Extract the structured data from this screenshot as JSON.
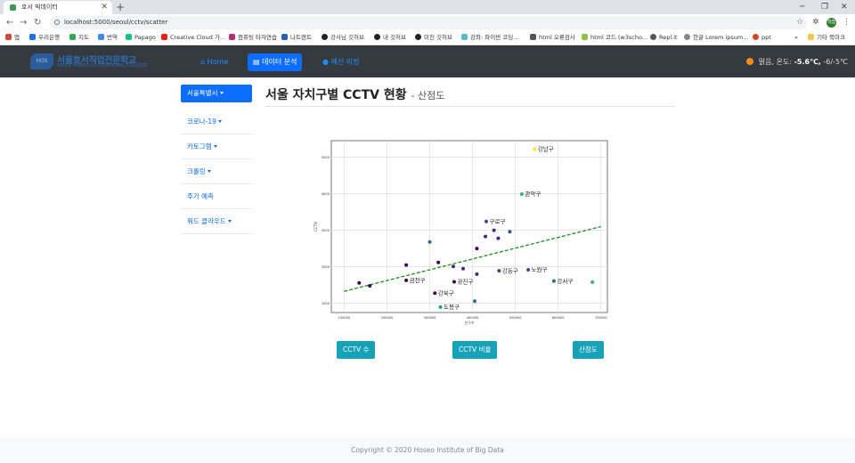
{
  "browser": {
    "tab_title": "호서 빅데이터",
    "url": "localhost:5000/seoul/cctv/scatter",
    "bookmarks": [
      "앱",
      "우리은행",
      "지도",
      "번역",
      "Papago",
      "Creative Cloud 가...",
      "컴퓨팅 타자연습",
      "나트렌트",
      "강사님 깃허브",
      "내 깃허브",
      "미진 깃허브",
      "강좌: 파이썬 코딩...",
      "html 오류검사",
      "html 코드 (w3scho...",
      "Repl.it",
      "한글 Lorem ipsum...",
      "ppt",
      "기타 북마크"
    ],
    "profile_badge": "학습"
  },
  "navbar": {
    "logo_title": "서울호서직업전문학교",
    "logo_subtitle": "SEOUL HOSEO OCCUPATIONAL COLLEGE",
    "items": [
      {
        "label": "Home",
        "active": false
      },
      {
        "label": "데이터 분석",
        "active": true
      },
      {
        "label": "예선 리빙",
        "active": false
      }
    ],
    "weather": {
      "condition": "맑음,",
      "temp_label": "온도:",
      "temp": "-5.6℃,",
      "range": "-6/-5℃"
    }
  },
  "sidebar": {
    "items": [
      {
        "label": "서울특별시",
        "dropdown": true,
        "active": true
      },
      {
        "label": "코로나-19",
        "dropdown": true,
        "active": false
      },
      {
        "label": "카토그램",
        "dropdown": true,
        "active": false
      },
      {
        "label": "크롤링",
        "dropdown": true,
        "active": false
      },
      {
        "label": "주가 예측",
        "dropdown": false,
        "active": false
      },
      {
        "label": "워드 클라우드",
        "dropdown": true,
        "active": false
      }
    ]
  },
  "main": {
    "title": "서울 자치구별 CCTV 현황",
    "subtitle": "- 산점도",
    "buttons": [
      "CCTV 수",
      "CCTV 비율",
      "산점도"
    ]
  },
  "chart_data": {
    "type": "scatter",
    "xlabel": "인구수",
    "ylabel": "CCTV",
    "xlim": [
      70000,
      715000
    ],
    "ylim": [
      750,
      5450
    ],
    "xticks": [
      100000,
      200000,
      300000,
      400000,
      500000,
      600000,
      700000
    ],
    "yticks": [
      1000,
      2000,
      3000,
      4000,
      5000
    ],
    "grid": true,
    "trendline": {
      "x": [
        100000,
        700000
      ],
      "y": [
        1330,
        3100
      ],
      "color": "#228b22",
      "style": "dashed"
    },
    "points": [
      {
        "x": 545000,
        "y": 5220,
        "label": "강남구",
        "color": "#fde725"
      },
      {
        "x": 515000,
        "y": 3990,
        "label": "관악구",
        "color": "#35b779"
      },
      {
        "x": 432000,
        "y": 3240,
        "label": "구로구",
        "color": "#3e4a89"
      },
      {
        "x": 450000,
        "y": 3000,
        "label": "",
        "color": "#482878"
      },
      {
        "x": 487000,
        "y": 2960,
        "label": "",
        "color": "#3e4a89"
      },
      {
        "x": 430000,
        "y": 2830,
        "label": "",
        "color": "#482878"
      },
      {
        "x": 460000,
        "y": 2780,
        "label": "",
        "color": "#482878"
      },
      {
        "x": 300000,
        "y": 2680,
        "label": "",
        "color": "#31688e"
      },
      {
        "x": 410000,
        "y": 2500,
        "label": "",
        "color": "#440154"
      },
      {
        "x": 245000,
        "y": 2050,
        "label": "",
        "color": "#440154"
      },
      {
        "x": 320000,
        "y": 2120,
        "label": "",
        "color": "#440154"
      },
      {
        "x": 355000,
        "y": 2010,
        "label": "",
        "color": "#482878"
      },
      {
        "x": 378000,
        "y": 1950,
        "label": "",
        "color": "#482878"
      },
      {
        "x": 462000,
        "y": 1890,
        "label": "강동구",
        "color": "#3e4a89"
      },
      {
        "x": 530000,
        "y": 1920,
        "label": "노원구",
        "color": "#3e4a89"
      },
      {
        "x": 410000,
        "y": 1800,
        "label": "",
        "color": "#482878"
      },
      {
        "x": 245000,
        "y": 1630,
        "label": "금천구",
        "color": "#440154"
      },
      {
        "x": 357000,
        "y": 1590,
        "label": "광진구",
        "color": "#440154"
      },
      {
        "x": 590000,
        "y": 1610,
        "label": "강서구",
        "color": "#31688e"
      },
      {
        "x": 680000,
        "y": 1580,
        "label": "",
        "color": "#35b779"
      },
      {
        "x": 135000,
        "y": 1560,
        "label": "",
        "color": "#440154"
      },
      {
        "x": 160000,
        "y": 1480,
        "label": "",
        "color": "#440154"
      },
      {
        "x": 312000,
        "y": 1280,
        "label": "강북구",
        "color": "#440154"
      },
      {
        "x": 405000,
        "y": 1060,
        "label": "",
        "color": "#31688e"
      },
      {
        "x": 325000,
        "y": 900,
        "label": "도봉구",
        "color": "#1f9e89"
      }
    ]
  },
  "footer": {
    "text": "Copyright © 2020 Hoseo Institute of Big Data"
  }
}
